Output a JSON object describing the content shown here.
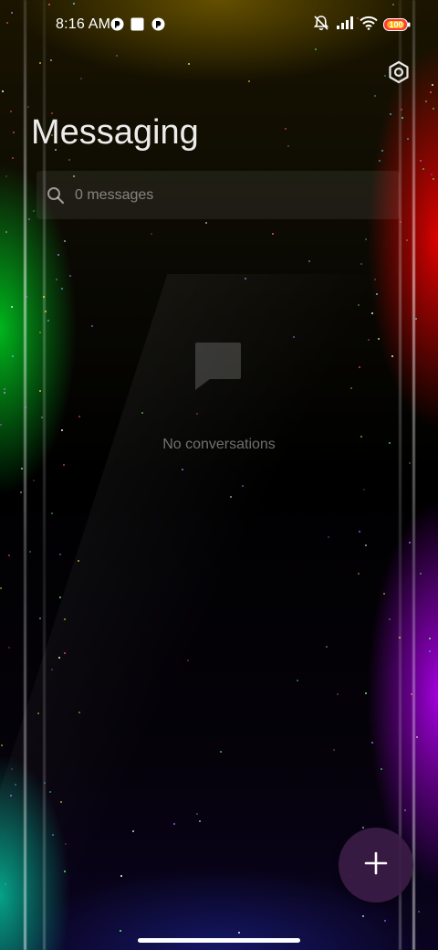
{
  "status_bar": {
    "time": "8:16 AM",
    "notification_icons": [
      "app-notification-icon",
      "square-notification-icon",
      "app-notification-icon"
    ],
    "right_icons": [
      "muted-bell-icon",
      "signal-icon",
      "wifi-icon",
      "battery-icon"
    ],
    "battery_level": "100"
  },
  "header": {
    "title": "Messaging",
    "settings_icon": "settings-hexagon-icon"
  },
  "search": {
    "placeholder": "0 messages",
    "value": "",
    "icon": "search-icon"
  },
  "empty_state": {
    "icon": "chat-bubble-icon",
    "text": "No conversations"
  },
  "fab": {
    "icon": "plus-icon"
  },
  "colors": {
    "title_text": "#ffffff",
    "muted_text": "#7a7a7a",
    "fab_background": "#3c1c46",
    "battery_accent": "#ff3b3b"
  }
}
